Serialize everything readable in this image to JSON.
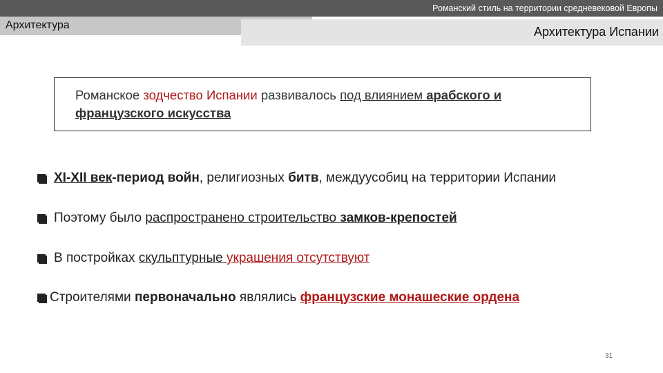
{
  "header": {
    "course_title": "Романский стиль на территории средневековой Европы",
    "section": "Архитектура",
    "subtitle": "Архитектура Испании"
  },
  "intro": {
    "p1": "Романское ",
    "p2": "зодчество Испании",
    "p3": " развивалось ",
    "p4": "под влиянием ",
    "p5": "арабского и французского искусства"
  },
  "bullets": {
    "b1": {
      "icon": "checkbox-bullet-icon",
      "t1": "XI-XII век",
      "t2": "-период войн",
      "t3": ", религиозных ",
      "t4": "битв",
      "t5": ", междуусобиц на территории Испании"
    },
    "b2": {
      "icon": "checkbox-bullet-icon",
      "t1": "Поэтому было ",
      "t2": "распространено строительство ",
      "t3": "замков-крепостей"
    },
    "b3": {
      "icon": "checkbox-bullet-icon",
      "t1": "В постройках ",
      "t2": "скульптурные ",
      "t3": "украшения отсутствуют"
    },
    "b4": {
      "icon": "checkbox-bullet-icon",
      "t1": "Строителями ",
      "t2": "первоначально",
      "t3": " являлись ",
      "t4": "французские монашеские ордена"
    }
  },
  "footer": {
    "page_number": "31"
  },
  "colors": {
    "accent_red": "#b01818",
    "header_band": "#595959",
    "section_tab": "#c7c7c7",
    "subtitle_bar": "#e4e4e4"
  }
}
